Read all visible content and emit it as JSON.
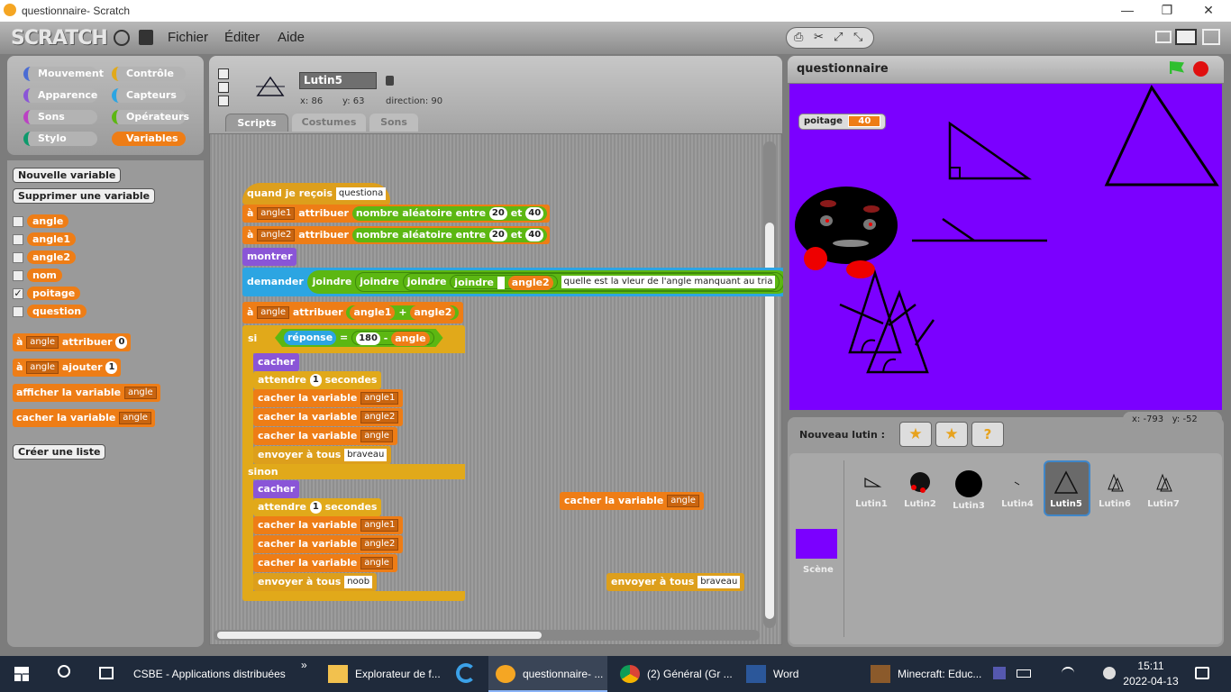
{
  "window": {
    "title": "questionnaire- Scratch",
    "min": "—",
    "max": "❐",
    "close": "✕"
  },
  "menubar": {
    "logo": "SCRATCH",
    "items": [
      "Fichier",
      "Éditer",
      "Aide"
    ]
  },
  "categories": [
    "Mouvement",
    "Contrôle",
    "Apparence",
    "Capteurs",
    "Sons",
    "Opérateurs",
    "Stylo",
    "Variables"
  ],
  "category_colors": [
    "#4a6cd4",
    "#e1a91a",
    "#8a55d7",
    "#2ca5e2",
    "#bb42c3",
    "#5cb712",
    "#0e9a6c",
    "#ee7d16"
  ],
  "palette": {
    "new_var": "Nouvelle variable",
    "del_var": "Supprimer une variable",
    "vars": [
      {
        "name": "angle",
        "checked": false
      },
      {
        "name": "angle1",
        "checked": false
      },
      {
        "name": "angle2",
        "checked": false
      },
      {
        "name": "nom",
        "checked": false
      },
      {
        "name": "poitage",
        "checked": true
      },
      {
        "name": "question",
        "checked": false
      }
    ],
    "check": "✓",
    "b_set_a": "à",
    "b_set_var": "angle",
    "b_set_lbl": "attribuer",
    "b_set_val": "0",
    "b_chg_a": "à",
    "b_chg_var": "angle",
    "b_chg_lbl": "ajouter",
    "b_chg_val": "1",
    "b_show": "afficher la variable",
    "b_show_var": "angle",
    "b_hide": "cacher la variable",
    "b_hide_var": "angle",
    "new_list": "Créer une liste"
  },
  "sprite": {
    "name": "Lutin5",
    "x": "x: 86",
    "y": "y: 63",
    "dir": "direction: 90"
  },
  "tabs": [
    "Scripts",
    "Costumes",
    "Sons"
  ],
  "script": {
    "hat": "quand je reçois",
    "hat_msg": "questiona",
    "a": "à",
    "attribuer": "attribuer",
    "v_angle1": "angle1",
    "v_angle2": "angle2",
    "v_angle": "angle",
    "rand": "nombre aléatoire entre",
    "r1": "20",
    "r2": "40",
    "et": "et",
    "montrer": "montrer",
    "demander": "demander",
    "joindre": "joindre",
    "ask_text": "quelle est la vleur de l'angle manquant au tria",
    "r_angle1": "angle1",
    "plus": "+",
    "r_angle2": "angle2",
    "si": "si",
    "reponse": "réponse",
    "eq": "=",
    "n180": "180",
    "minus": "-",
    "r_angle": "angle",
    "cacher": "cacher",
    "attendre": "attendre",
    "wait_n": "1",
    "secondes": "secondes",
    "cacher_var": "cacher la variable",
    "envoyer": "envoyer à tous",
    "msg_bravo": "braveau",
    "msg_noob": "noob",
    "sinon": "sinon",
    "loose1_var": "angle",
    "loose2_msg": "braveau"
  },
  "stage": {
    "title": "questionnaire",
    "watcher_name": "poitage",
    "watcher_value": "40",
    "bg": "#7b00ff"
  },
  "sprites_panel": {
    "new_label": "Nouveau lutin :",
    "mouse_x": "x: -793",
    "mouse_y": "y: -52",
    "scene": "Scène",
    "sprites": [
      "Lutin1",
      "Lutin2",
      "Lutin3",
      "Lutin4",
      "Lutin5",
      "Lutin6",
      "Lutin7"
    ],
    "selected": "Lutin5"
  },
  "taskbar": {
    "items": [
      "CSBE - Applications distribuées",
      "Explorateur de f...",
      "questionnaire- ...",
      "(2) Général (Gr ...",
      "Word",
      "Minecraft: Educ..."
    ],
    "time": "15:11",
    "date": "2022-04-13"
  }
}
